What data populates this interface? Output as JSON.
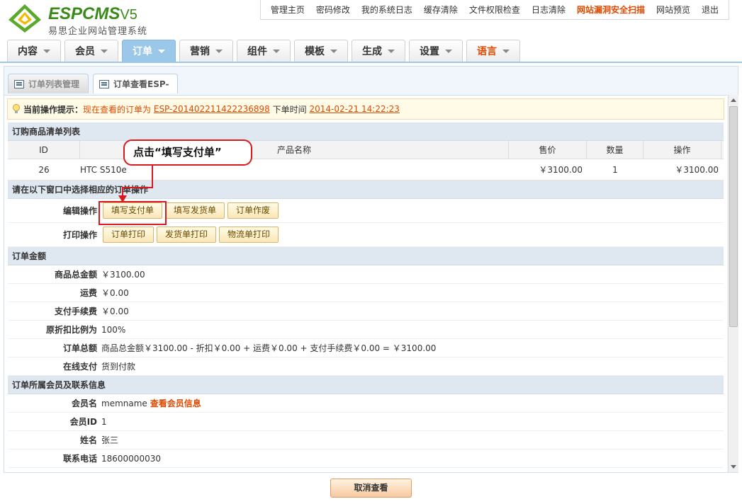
{
  "logo": {
    "brand": "ESPCMS",
    "version": "V5",
    "subtitle": "易思企业网站管理系统"
  },
  "topnav": [
    "管理主页",
    "密码修改",
    "我的系统日志",
    "缓存清除",
    "文件权限检查",
    "日志清除",
    "网站漏洞安全扫描",
    "网站预览",
    "退出"
  ],
  "mainnav": [
    "内容",
    "会员",
    "订单",
    "营销",
    "组件",
    "模板",
    "生成",
    "设置",
    "语言"
  ],
  "subtabs": [
    "订单列表管理",
    "订单查看ESP-"
  ],
  "hint": {
    "label": "当前操作提示：",
    "text1": "现在查看的订单为",
    "order_no": "ESP-201402211422236898",
    "text2": "下单时间",
    "order_time": "2014-02-21 14:22:23"
  },
  "goods": {
    "title": "订购商品清单列表",
    "headers": [
      "ID",
      "产品名称",
      "售价",
      "数量",
      "操作"
    ],
    "row": {
      "id": "26",
      "name": "HTC S510e",
      "price": "￥3100.00",
      "qty": "1",
      "op": "￥3100.00"
    }
  },
  "ops": {
    "title": "请在以下窗口中选择相应的订单操作",
    "edit_label": "编辑操作",
    "edit_buttons": [
      "填写支付单",
      "填写发货单",
      "订单作废"
    ],
    "print_label": "打印操作",
    "print_buttons": [
      "订单打印",
      "发货单打印",
      "物流单打印"
    ]
  },
  "amount": {
    "title": "订单金额",
    "rows": [
      {
        "k": "商品总金额",
        "v": "￥3100.00"
      },
      {
        "k": "运费",
        "v": "￥0.00"
      },
      {
        "k": "支付手续费",
        "v": "￥0.00"
      },
      {
        "k": "原折扣比例为",
        "v": "100%"
      },
      {
        "k": "订单总额",
        "v": "商品总金额￥3100.00 - 折扣￥0.00 + 运费￥0.00 + 支付手续费￥0.00 = ￥3100.00"
      },
      {
        "k": "在线支付",
        "v": "货到付款"
      }
    ]
  },
  "member": {
    "title": "订单所属会员及联系信息",
    "name_k": "会员名",
    "name_v": "memname",
    "name_link": "查看会员信息",
    "id_k": "会员ID",
    "id_v": "1",
    "realname_k": "姓名",
    "realname_v": "张三",
    "phone_k": "联系电话",
    "phone_v": "18600000030"
  },
  "cancel_button": "取消查看",
  "callout": "点击“填写支付单”",
  "colors": {
    "accent": "#9bc7e8",
    "warning": "#e04a00",
    "annotation": "#d9191b"
  }
}
